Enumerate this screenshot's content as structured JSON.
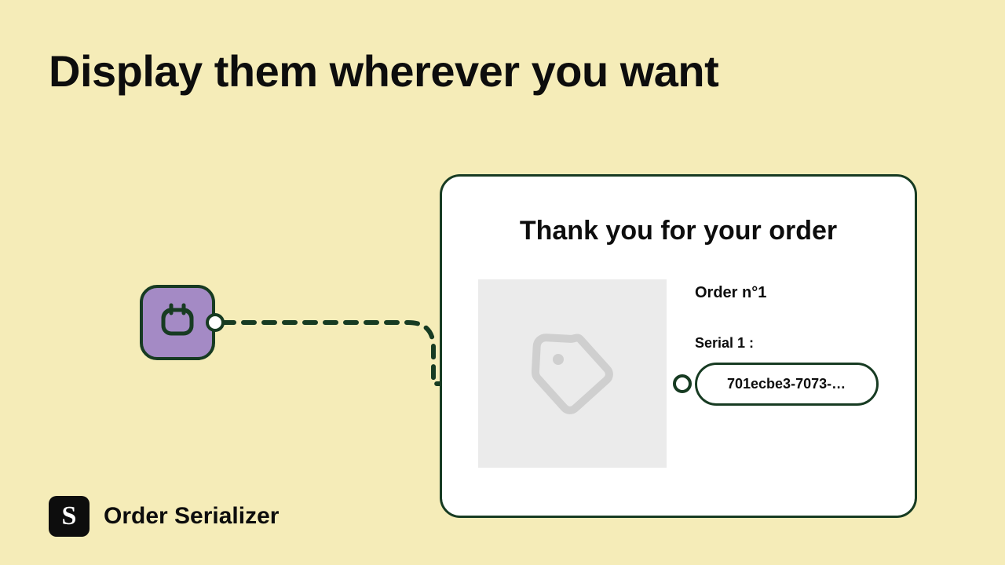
{
  "headline": "Display them wherever you want",
  "brand": {
    "badge_letter": "S",
    "name": "Order Serializer"
  },
  "card": {
    "title": "Thank you for your order",
    "order_label": "Order n°1",
    "serial_label": "Serial 1 :",
    "serial_value": "701ecbe3-7073-…"
  },
  "colors": {
    "bg": "#f5ecb8",
    "dark_green": "#173b22",
    "node_fill": "#a48ac5",
    "thumb_bg": "#ebebeb",
    "thumb_icon": "#cfcfcf"
  },
  "icons": {
    "source_node": "calendar-icon",
    "product_thumb": "tag-icon"
  }
}
